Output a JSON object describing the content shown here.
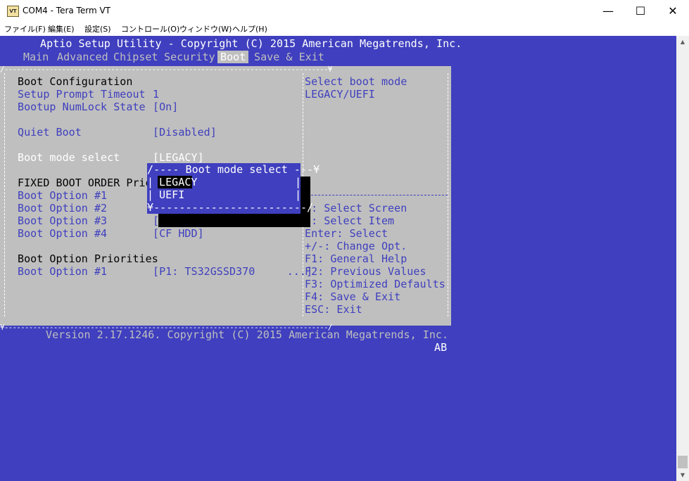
{
  "window": {
    "icon_label": "VT",
    "title": "COM4 - Tera Term VT",
    "minimize": "—",
    "maximize": "☐",
    "close": "✕"
  },
  "menu": [
    "ファイル(F)",
    "編集(E)",
    "設定(S)",
    "コントロール(O)",
    "ウィンドウ(W)",
    "ヘルプ(H)"
  ],
  "bios": {
    "header": "Aptio Setup Utility - Copyright (C) 2015 American Megatrends, Inc.",
    "tabs": [
      "Main",
      "Advanced",
      "Chipset",
      "Security",
      "Boot",
      "Save & Exit"
    ],
    "active_tab": "Boot",
    "border_top": "/-------------------------------------------------------------------------------¥",
    "border_bottom": "¥-------------------------------------------------------------------------------/",
    "left_lines": [
      "Boot Configuration",
      "Setup Prompt Timeout",
      "Bootup NumLock State",
      "Quiet Boot",
      "Boot mode select",
      "FIXED BOOT ORDER Priori",
      "Boot Option #1",
      "Boot Option #2",
      "Boot Option #3",
      "Boot Option #4",
      "Boot Option Priorities",
      "Boot Option #1"
    ],
    "values": {
      "timeout": "1",
      "numlock": "[On]",
      "quiet": "[Disabled]",
      "mode": "[LEGACY]",
      "opt3": "[",
      "opt4": "[CF HDD]",
      "priority1": "[P1: TS32GSSD370     ...]"
    },
    "help": [
      "Select boot mode",
      "LEGACY/UEFI"
    ],
    "keys": [
      "<: Select Screen",
      "v: Select Item",
      "Enter: Select",
      "+/-: Change Opt.",
      "F1: General Help",
      "F2: Previous Values",
      "F3: Optimized Defaults",
      "F4: Save & Exit",
      "ESC: Exit"
    ],
    "popup": {
      "top": "/---- Boot mode select ---¥",
      "bottom": "¥------------------------/",
      "options": [
        "LEGACY",
        "UEFI"
      ],
      "selected": "LEGACY"
    },
    "version": "Version 2.17.1246. Copyright (C) 2015 American Megatrends, Inc.",
    "status": "AB"
  }
}
